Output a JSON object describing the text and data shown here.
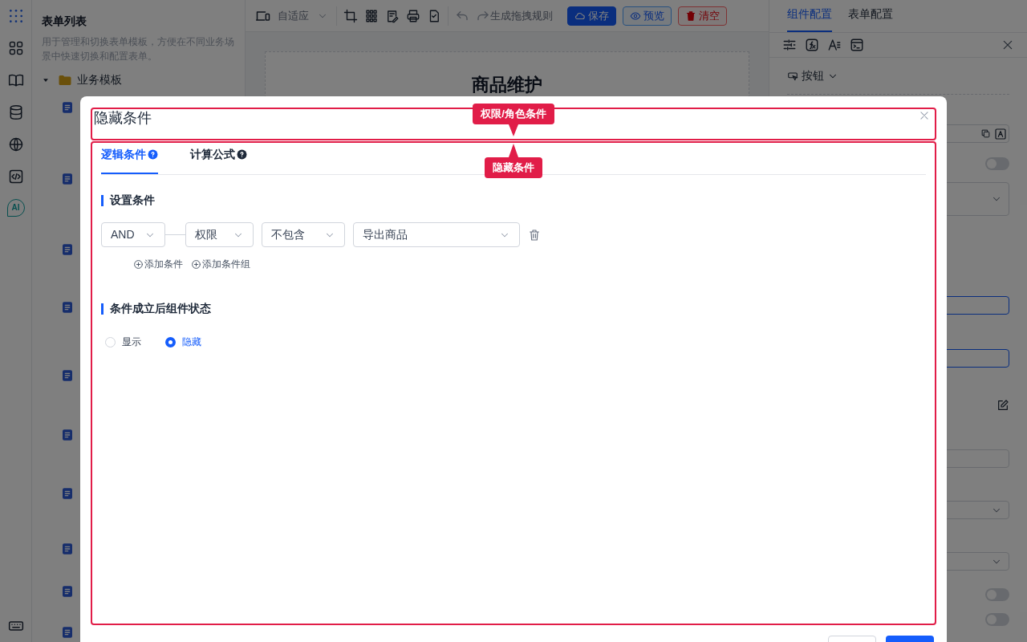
{
  "icon_rail": {
    "assistant_label": "AI"
  },
  "sidebar": {
    "title": "表单列表",
    "description": "用于管理和切换表单模板，方便在不同业务场景中快速切换和配置表单。",
    "tree": [
      {
        "label": "业务模板",
        "expanded": true,
        "children": [
          {
            "kind": "document"
          },
          {
            "kind": "document"
          },
          {
            "kind": "document"
          },
          {
            "kind": "document"
          },
          {
            "kind": "document"
          },
          {
            "kind": "document"
          },
          {
            "kind": "document"
          },
          {
            "kind": "document"
          },
          {
            "kind": "document"
          },
          {
            "kind": "document"
          }
        ]
      }
    ]
  },
  "toolbar": {
    "layout_select": "自适应",
    "rule_link": "生成拖拽规则",
    "buttons": [
      {
        "label": "保存",
        "kind": "primary"
      },
      {
        "label": "预览",
        "kind": "outline"
      },
      {
        "label": "清空",
        "kind": "danger"
      }
    ]
  },
  "canvas": {
    "form_title": "商品维护"
  },
  "right_panel": {
    "tabs": [
      {
        "label": "组件配置",
        "selected": true
      },
      {
        "label": "表单配置",
        "selected": false
      }
    ],
    "component_type": "按钮",
    "fields": [
      {
        "kind": "input",
        "focused": false
      },
      {
        "kind": "toggle",
        "on": false
      },
      {
        "kind": "select",
        "focused": false
      },
      {
        "kind": "input",
        "focused": true
      },
      {
        "kind": "input",
        "focused": true
      },
      {
        "kind": "edit"
      },
      {
        "kind": "input",
        "focused": false
      },
      {
        "kind": "select",
        "focused": false
      },
      {
        "kind": "select",
        "focused": false
      },
      {
        "kind": "toggle",
        "on": false
      },
      {
        "kind": "toggle",
        "on": false
      }
    ]
  },
  "modal": {
    "title": "隐藏条件",
    "tabs": [
      {
        "label": "逻辑条件",
        "selected": true
      },
      {
        "label": "计算公式",
        "selected": false
      }
    ],
    "condition_section": "设置条件",
    "condition": {
      "logic": "AND",
      "field": "权限",
      "operator": "不包含",
      "value": "导出商品"
    },
    "add_actions": [
      "添加条件",
      "添加条件组"
    ],
    "state_section": "条件成立后组件状态",
    "state_options": [
      {
        "label": "显示",
        "selected": false
      },
      {
        "label": "隐藏",
        "selected": true
      }
    ]
  },
  "annotations": [
    {
      "label": "权限/角色条件"
    },
    {
      "label": "隐藏条件"
    }
  ]
}
